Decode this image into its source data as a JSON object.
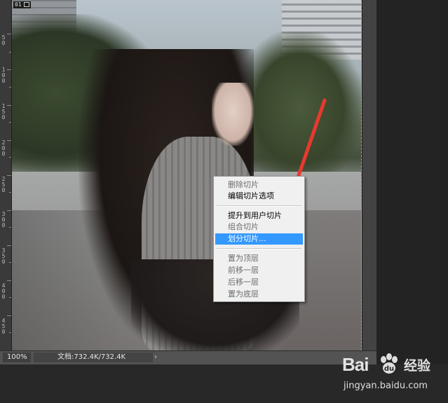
{
  "document": {
    "tab_label": "01"
  },
  "ruler": {
    "labels": [
      "5\n0",
      "1\n0\n0",
      "1\n5\n0",
      "2\n0\n0",
      "2\n5\n0",
      "3\n0\n0",
      "3\n5\n0",
      "4\n0\n0",
      "4\n5\n0"
    ]
  },
  "context_menu": {
    "group1": [
      "删除切片",
      "编辑切片选项"
    ],
    "group2": [
      "提升到用户切片",
      "组合切片",
      "划分切片..."
    ],
    "group3": [
      "置为顶层",
      "前移一层",
      "后移一层",
      "置为底层"
    ],
    "disabled": [
      "删除切片",
      "组合切片",
      "置为顶层",
      "前移一层",
      "后移一层",
      "置为底层"
    ],
    "highlighted": "划分切片..."
  },
  "status_bar": {
    "zoom": "100%",
    "doc_info": "文档:732.4K/732.4K",
    "arrow": "›"
  },
  "watermark": {
    "brand": "Bai",
    "brand_suffix": "经验",
    "url": "jingyan.baidu.com"
  },
  "colors": {
    "menu_highlight": "#3399ff",
    "arrow_red": "#e8392f"
  }
}
